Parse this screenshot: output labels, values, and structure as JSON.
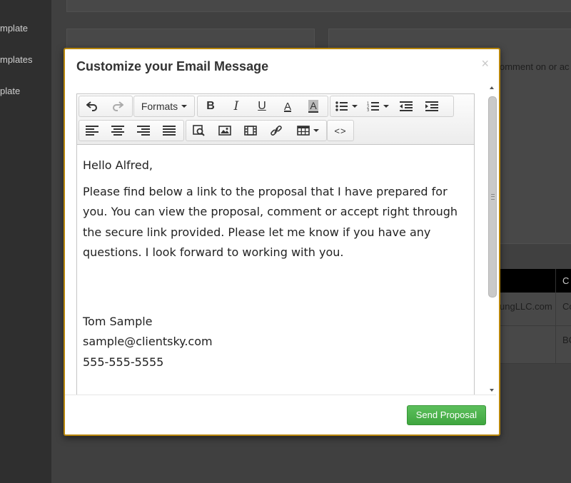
{
  "background": {
    "sidebar_items": [
      "mplate",
      "mplates",
      "plate"
    ],
    "panel_left_heading": "",
    "panel_right_text": "omment on or ac",
    "table_rows": [
      {
        "col1": "ungLLC.com",
        "col2": "Co"
      },
      {
        "col1": "",
        "col2": "BC"
      }
    ],
    "table_header_col2": "C"
  },
  "modal": {
    "title": "Customize your Email Message",
    "close_label": "×"
  },
  "toolbar": {
    "formats_label": "Formats",
    "bold_label": "B",
    "italic_label": "I",
    "underline_label": "U",
    "text_color_label": "A",
    "bg_color_label": "A",
    "code_label": "<>"
  },
  "email": {
    "greeting": "Hello Alfred,",
    "body": "Please find below a link to the proposal that I have prepared for you. You can view the proposal, comment or accept right through the secure link provided. Please let me know if you have any questions. I look forward to working with you.",
    "signature_name": "Tom Sample",
    "signature_email": "sample@clientsky.com",
    "signature_phone": "555-555-5555"
  },
  "footer": {
    "send_label": "Send Proposal"
  },
  "colors": {
    "modal_border": "#b8860b",
    "send_button": "#4cae4c"
  }
}
